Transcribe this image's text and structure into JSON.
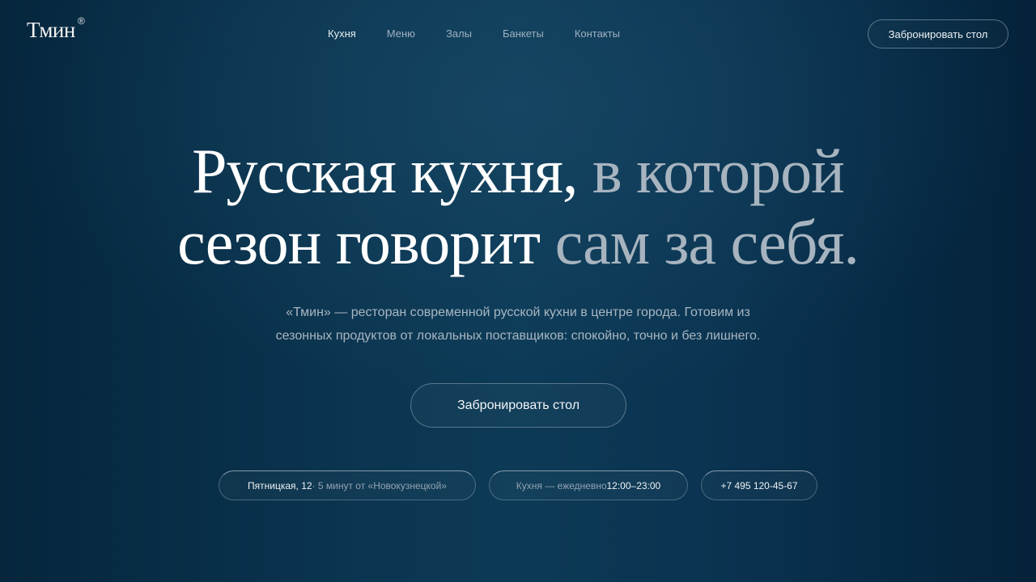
{
  "brand": {
    "name": "Тмин",
    "mark": "®"
  },
  "nav": {
    "items": [
      {
        "label": "Кухня",
        "active": true
      },
      {
        "label": "Меню",
        "active": false
      },
      {
        "label": "Залы",
        "active": false
      },
      {
        "label": "Банкеты",
        "active": false
      },
      {
        "label": "Контакты",
        "active": false
      }
    ]
  },
  "header": {
    "cta_label": "Забронировать стол"
  },
  "hero": {
    "title_part1": "Русская кухня,",
    "title_part2": "в которой",
    "title_part3": "сезон говорит",
    "title_part4": "сам за себя.",
    "subtitle_line1": "«Тмин» — ресторан современной русской кухни в центре города. Готовим из",
    "subtitle_line2": "сезонных продуктов от локальных поставщиков: спокойно, точно и без лишнего.",
    "cta_label": "Забронировать стол"
  },
  "info": {
    "address_strong": "Пятницкая, 12",
    "address_rest": " · 5 минут от «Новокузнецкой»",
    "hours_label": "Кухня — ежедневно ",
    "hours_value": "12:00–23:00",
    "phone": "+7 495 120-45-67"
  },
  "colors": {
    "background": "#0b3550",
    "text_primary": "#ffffff",
    "text_muted": "#a7b4bf"
  }
}
